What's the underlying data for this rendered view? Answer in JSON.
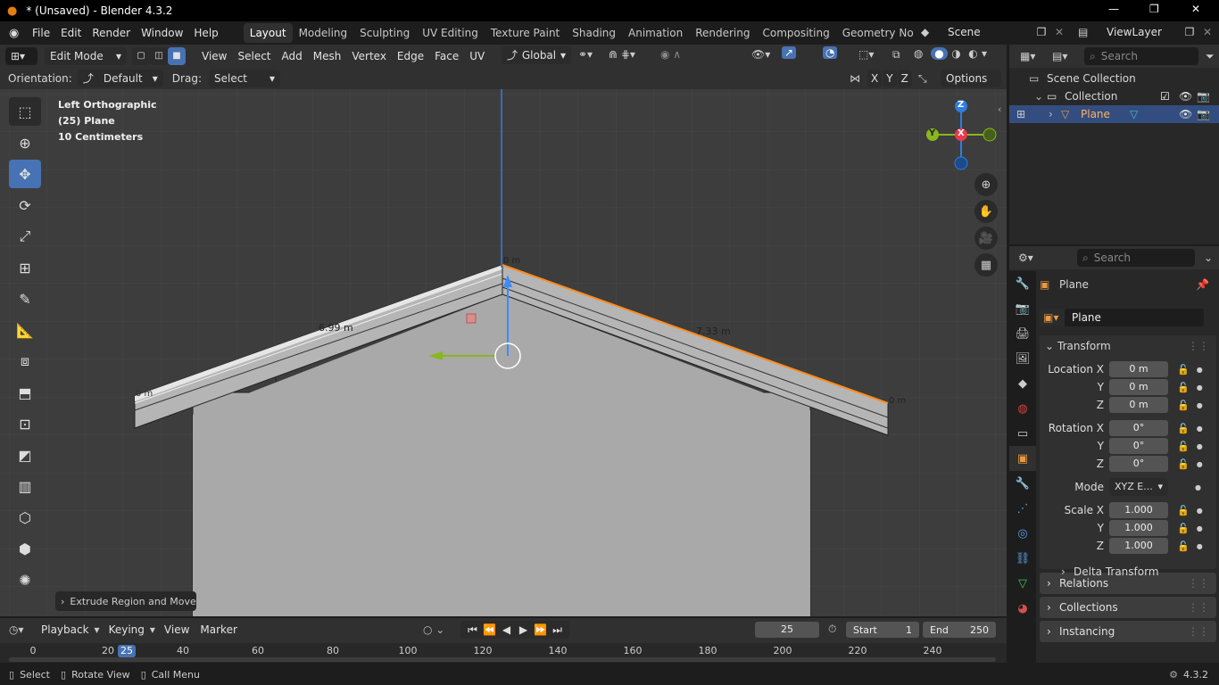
{
  "window": {
    "title": "* (Unsaved) - Blender 4.3.2",
    "min": "—",
    "max": "❐",
    "close": "✕"
  },
  "menu": [
    "File",
    "Edit",
    "Render",
    "Window",
    "Help"
  ],
  "workspaces": [
    "Layout",
    "Modeling",
    "Sculpting",
    "UV Editing",
    "Texture Paint",
    "Shading",
    "Animation",
    "Rendering",
    "Compositing",
    "Geometry Node"
  ],
  "scene": "Scene",
  "viewlayer": "ViewLayer",
  "header": {
    "mode": "Edit Mode",
    "menus": [
      "View",
      "Select",
      "Add",
      "Mesh",
      "Vertex",
      "Edge",
      "Face",
      "UV"
    ],
    "transform": "Global"
  },
  "tool_settings": {
    "orientation_label": "Orientation:",
    "orientation": "Default",
    "drag_label": "Drag:",
    "drag": "Select Box",
    "options": "Options",
    "axes": [
      "X",
      "Y",
      "Z"
    ]
  },
  "overlay_text": {
    "view": "Left Orthographic",
    "object": "(25) Plane",
    "scale": "10 Centimeters"
  },
  "measure": {
    "left_len": "6.99 m",
    "right_len": "7.33 m",
    "peak": "0 m",
    "left_end": "0 m",
    "right_end": "0 m"
  },
  "gizmo": {
    "z": "Z",
    "y": "Y",
    "x": "X"
  },
  "last_op": "Extrude Region and Move",
  "outliner": {
    "search": "Search",
    "root": "Scene Collection",
    "collection": "Collection",
    "object": "Plane"
  },
  "properties": {
    "search": "Search",
    "object_name": "Plane",
    "data_name": "Plane",
    "transform_title": "Transform",
    "loc_label": "Location X",
    "rot_label": "Rotation X",
    "scale_label": "Scale X",
    "y": "Y",
    "z": "Z",
    "location": [
      "0 m",
      "0 m",
      "0 m"
    ],
    "rotation": [
      "0°",
      "0°",
      "0°"
    ],
    "mode_label": "Mode",
    "mode": "XYZ E...",
    "scale": [
      "1.000",
      "1.000",
      "1.000"
    ],
    "delta": "Delta Transform",
    "relations": "Relations",
    "collections": "Collections",
    "instancing": "Instancing"
  },
  "timeline": {
    "menus": [
      "Playback",
      "Keying",
      "View",
      "Marker"
    ],
    "frame": "25",
    "start_label": "Start",
    "start": "1",
    "end_label": "End",
    "end": "250",
    "ticks": [
      "0",
      "20",
      "40",
      "60",
      "80",
      "100",
      "120",
      "140",
      "160",
      "180",
      "200",
      "220",
      "240"
    ],
    "current_tick": "25"
  },
  "status": {
    "select": "Select",
    "rotate": "Rotate View",
    "menu": "Call Menu",
    "version": "4.3.2"
  },
  "colors": {
    "accent": "#4772b3",
    "edge_highlight": "#ff8c1a",
    "x_axis": "#e8394d",
    "y_axis": "#8ab61e",
    "z_axis": "#2f7de1"
  }
}
